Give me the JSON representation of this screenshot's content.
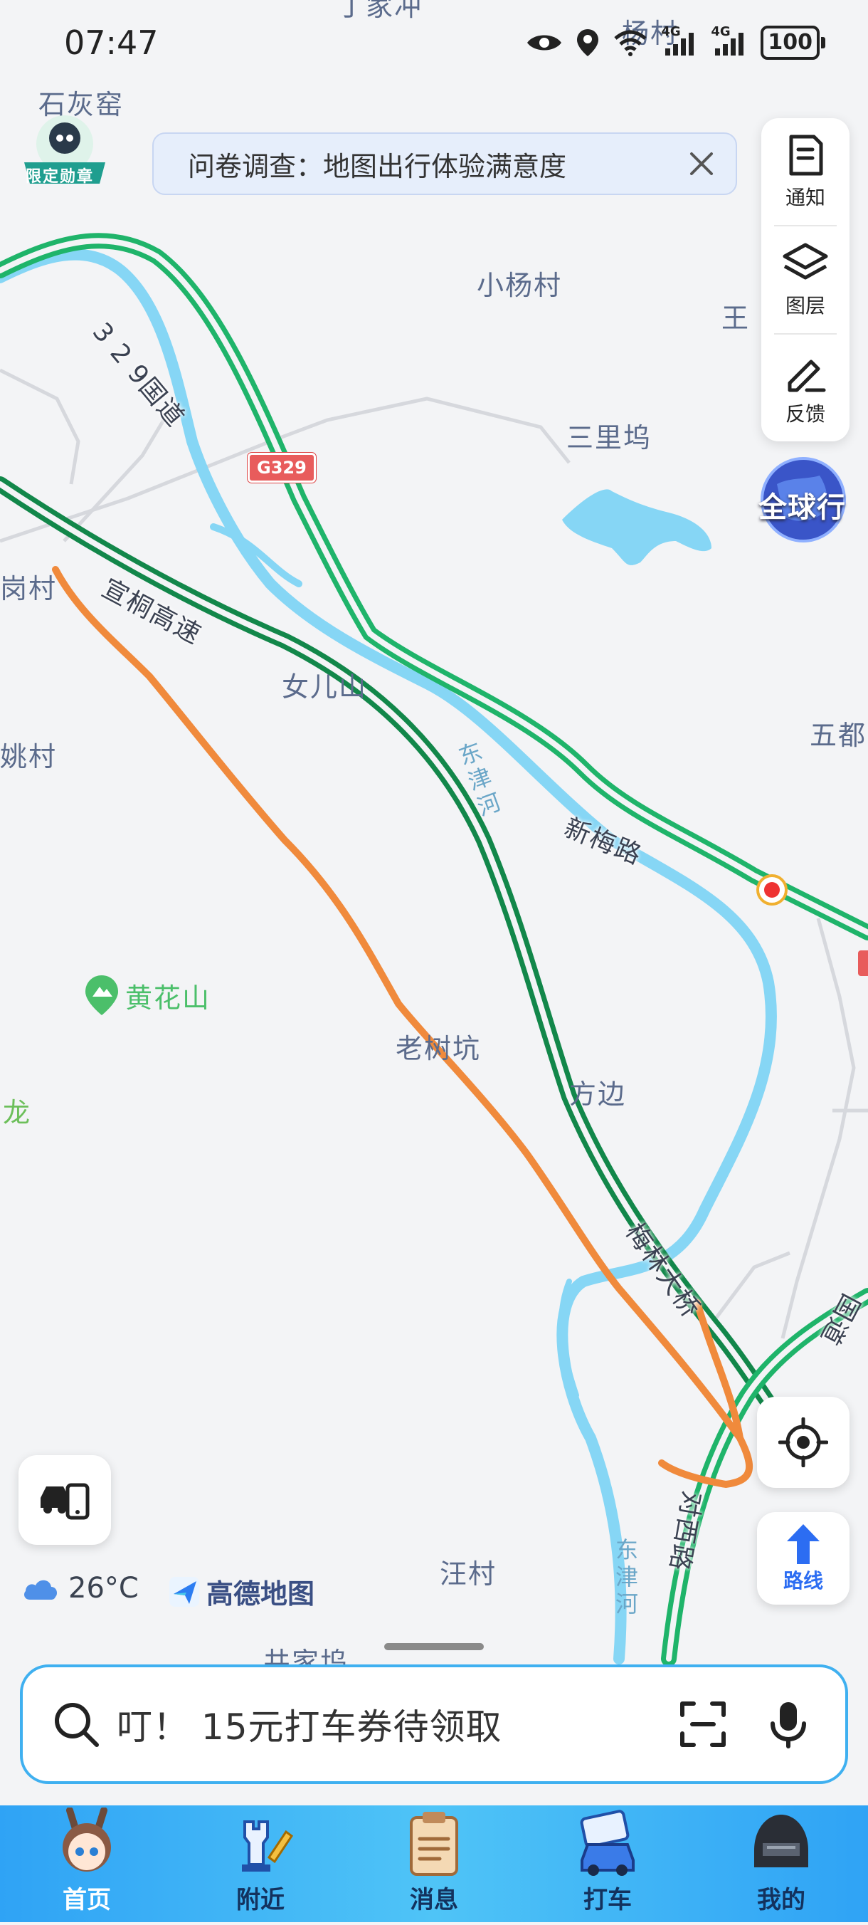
{
  "status_bar": {
    "time": "07:47",
    "battery": "100",
    "network_1": "4G",
    "network_2": "4G"
  },
  "badge": {
    "label": "限定勋章"
  },
  "survey": {
    "text": "问卷调查：地图出行体验满意度"
  },
  "tools": {
    "notify": "通知",
    "layers": "图层",
    "feedback": "反馈"
  },
  "global_btn": {
    "label": "全球行"
  },
  "map": {
    "places": {
      "shihuiyao": "石灰窑",
      "dingjiachong": "丁家冲",
      "yangcun": "杨村",
      "xiaoyangcun": "小杨村",
      "wang": "王",
      "sanliwu": "三里坞",
      "gangcun": "岗村",
      "nverershan": "女儿山",
      "taocun": "姚村",
      "wudu": "五都",
      "huanghuashan": "黄花山",
      "laoshukeng": "老树坑",
      "fangbian": "方边",
      "long": "龙",
      "wangcun": "汪村",
      "jingjiawu": "井家坞"
    },
    "roads": {
      "g329_label": "3 2 9国道",
      "g329_shield": "G329",
      "xuantong": "宣桐高速",
      "xinmei": "新梅路",
      "meilin": "梅林大桥",
      "duixi": "对西路",
      "guodao": "国道"
    },
    "water": {
      "dongjin_1": "东津河",
      "dongjin_2": "东津河"
    }
  },
  "weather": {
    "temp": "26°C"
  },
  "amap": {
    "name": "高德地图"
  },
  "route_btn": {
    "label": "路线"
  },
  "search": {
    "placeholder": "叮！ 15元打车券待领取"
  },
  "nav": {
    "items": [
      {
        "label": "首页"
      },
      {
        "label": "附近"
      },
      {
        "label": "消息"
      },
      {
        "label": "打车"
      },
      {
        "label": "我的"
      }
    ]
  },
  "colors": {
    "accent": "#2fa3f5",
    "route_orange": "#f08a3c",
    "highway_green": "#1fb46a",
    "river_blue": "#86d6f5"
  }
}
